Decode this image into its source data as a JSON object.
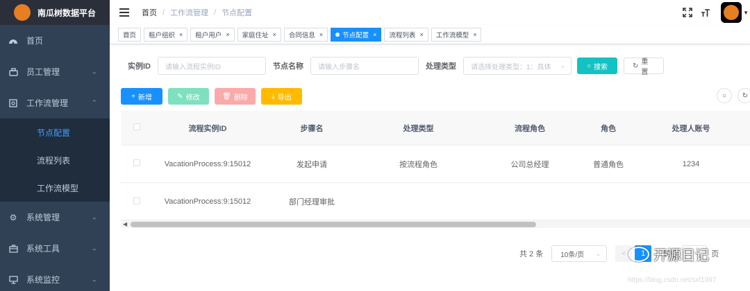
{
  "app": {
    "title": "南瓜树数据平台"
  },
  "sidebar": {
    "items": [
      {
        "label": "首页",
        "icon": "dashboard-icon"
      },
      {
        "label": "员工管理",
        "icon": "user-icon"
      },
      {
        "label": "工作流管理",
        "icon": "workflow-icon"
      },
      {
        "label": "系统管理",
        "icon": "gear-icon"
      },
      {
        "label": "系统工具",
        "icon": "toolbox-icon"
      },
      {
        "label": "系统监控",
        "icon": "monitor-icon"
      }
    ],
    "workflow_sub": [
      {
        "label": "节点配置",
        "active": true
      },
      {
        "label": "流程列表",
        "active": false
      },
      {
        "label": "工作流模型",
        "active": false
      }
    ]
  },
  "navbar": {
    "breadcrumb": [
      "首页",
      "工作流管理",
      "节点配置"
    ],
    "breadcrumb_sep": "/"
  },
  "tags": [
    {
      "label": "首页",
      "closable": false
    },
    {
      "label": "租户组织",
      "closable": true
    },
    {
      "label": "租户用户",
      "closable": true
    },
    {
      "label": "家庭住址",
      "closable": true
    },
    {
      "label": "合同信息",
      "closable": true
    },
    {
      "label": "节点配置",
      "closable": true,
      "active": true
    },
    {
      "label": "流程列表",
      "closable": true
    },
    {
      "label": "工作流模型",
      "closable": true
    }
  ],
  "search": {
    "instance_label": "实例ID",
    "instance_placeholder": "请输入流程实例ID",
    "node_label": "节点名称",
    "node_placeholder": "请输入步骤名",
    "type_label": "处理类型",
    "type_placeholder": "请选择处理类型：1：具体",
    "search_button": "搜索",
    "reset_button": "重置"
  },
  "toolbar": {
    "add": "新增",
    "edit": "修改",
    "delete": "删除",
    "export": "导出"
  },
  "table": {
    "columns": [
      "流程实例ID",
      "步骤名",
      "处理类型",
      "流程角色",
      "角色",
      "处理人账号"
    ],
    "rows": [
      [
        "VacationProcess:9:15012",
        "发起申请",
        "按流程角色",
        "公司总经理",
        "普通角色",
        "1234"
      ],
      [
        "VacationProcess:9:15012",
        "部门经理审批",
        "",
        "",
        "",
        ""
      ]
    ]
  },
  "pagination": {
    "total": "共 2 条",
    "page_size": "10条/页",
    "current": "1",
    "goto": "前往",
    "page_suffix": "页"
  },
  "watermark": {
    "brand": "开源日记",
    "url": "https://blog.csdn.net/sxf1997"
  },
  "colors": {
    "sidebar_bg": "#304156",
    "primary": "#1890ff",
    "search_btn": "#13c2c2",
    "edit_btn": "#7ee0bf",
    "delete_btn": "#fbaaaa",
    "export_btn": "#ffba00"
  }
}
